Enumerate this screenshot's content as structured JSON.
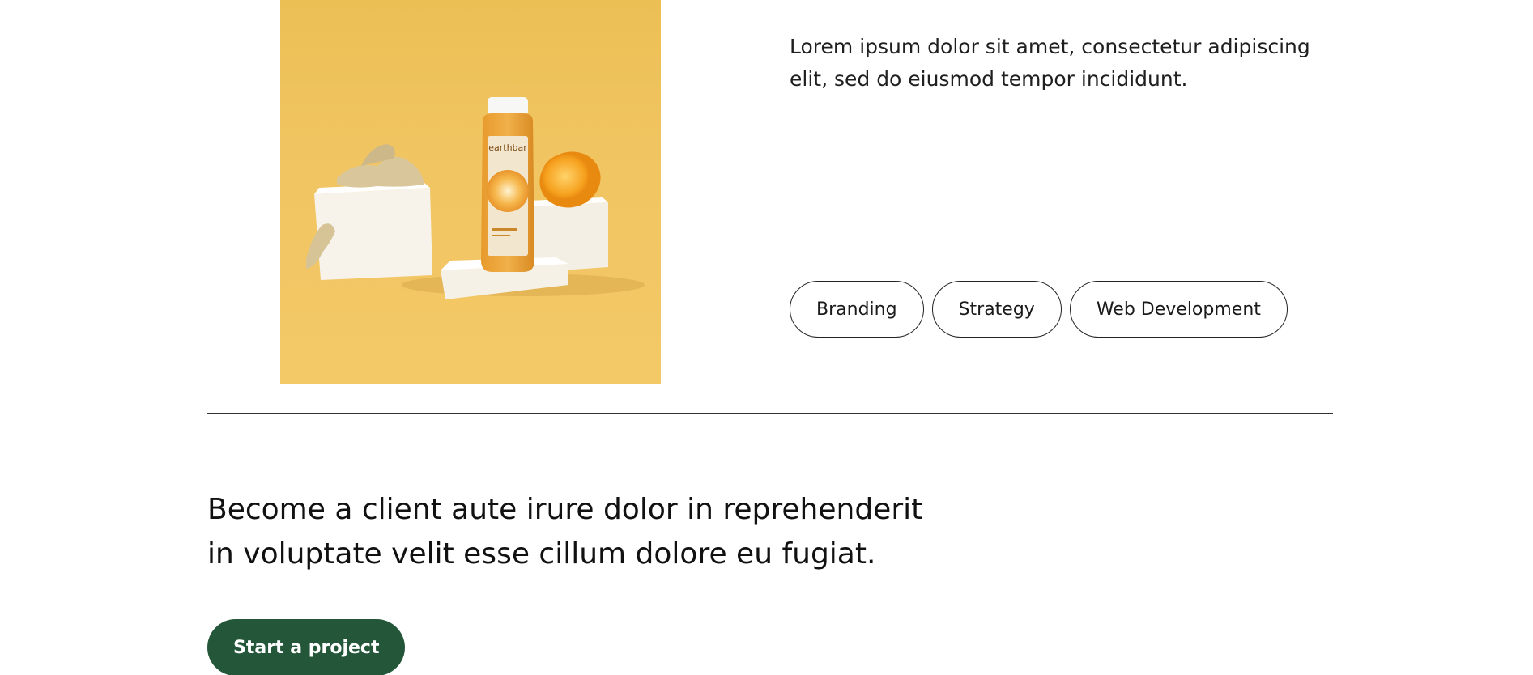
{
  "project": {
    "image_alt": "earthbar juice bottle with ginger and orange on white cubes",
    "bottle_brand": "earthbar",
    "description": "Lorem ipsum dolor sit amet, consectetur adipiscing elit, sed do eiusmod tempor incididunt.",
    "tags": [
      "Branding",
      "Strategy",
      "Web Development"
    ]
  },
  "cta": {
    "heading": "Become a client aute irure dolor in reprehenderit in voluptate velit esse cillum dolore eu fugiat.",
    "button_label": "Start a project"
  },
  "colors": {
    "photo_background": "#f1c562",
    "button_background": "#24573a",
    "text": "#1a1a1a"
  }
}
